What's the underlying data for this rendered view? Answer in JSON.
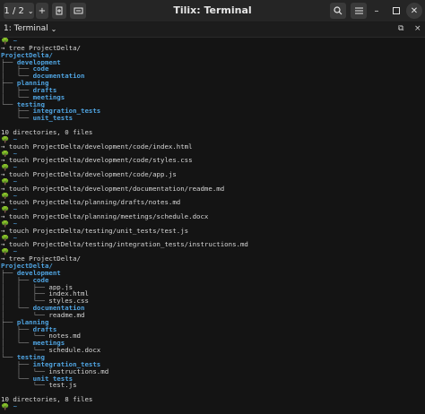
{
  "window": {
    "title": "Tilix: Terminal",
    "session_counter": "1 / 2",
    "add_label": "+",
    "icons": {
      "dropdown": "chevron-down-icon",
      "new_tab": "new-session-icon",
      "sync": "sync-input-icon",
      "search": "search-icon",
      "menu": "hamburger-menu-icon",
      "minimize": "minimize-icon",
      "maximize": "maximize-icon",
      "close": "close-icon"
    }
  },
  "tab": {
    "label": "1: Terminal",
    "maximize_glyph": "⧉",
    "close_glyph": "×"
  },
  "colors": {
    "prompt": "#6ab04c",
    "directory": "#4fa3e0",
    "tree": "#8a8a8a",
    "background": "#141414"
  },
  "terminal": {
    "prompt_symbol": "🌳",
    "tilde": "~",
    "arrow": "→",
    "lines": [
      {
        "t": "prompt"
      },
      {
        "t": "cmd",
        "text": "tree ProjectDelta/"
      },
      {
        "t": "tree",
        "prefix": "",
        "name": "ProjectDelta/",
        "dir": true
      },
      {
        "t": "tree",
        "prefix": "├── ",
        "name": "development",
        "dir": true
      },
      {
        "t": "tree",
        "prefix": "│   ├── ",
        "name": "code",
        "dir": true
      },
      {
        "t": "tree",
        "prefix": "│   └── ",
        "name": "documentation",
        "dir": true
      },
      {
        "t": "tree",
        "prefix": "├── ",
        "name": "planning",
        "dir": true
      },
      {
        "t": "tree",
        "prefix": "│   ├── ",
        "name": "drafts",
        "dir": true
      },
      {
        "t": "tree",
        "prefix": "│   └── ",
        "name": "meetings",
        "dir": true
      },
      {
        "t": "tree",
        "prefix": "└── ",
        "name": "testing",
        "dir": true
      },
      {
        "t": "tree",
        "prefix": "    ├── ",
        "name": "integration_tests",
        "dir": true
      },
      {
        "t": "tree",
        "prefix": "    └── ",
        "name": "unit_tests",
        "dir": true
      },
      {
        "t": "blank"
      },
      {
        "t": "out",
        "text": "10 directories, 0 files"
      },
      {
        "t": "prompt"
      },
      {
        "t": "cmd",
        "text": "touch ProjectDelta/development/code/index.html"
      },
      {
        "t": "prompt"
      },
      {
        "t": "cmd",
        "text": "touch ProjectDelta/development/code/styles.css"
      },
      {
        "t": "prompt"
      },
      {
        "t": "cmd",
        "text": "touch ProjectDelta/development/code/app.js"
      },
      {
        "t": "prompt"
      },
      {
        "t": "cmd",
        "text": "touch ProjectDelta/development/documentation/readme.md"
      },
      {
        "t": "prompt"
      },
      {
        "t": "cmd",
        "text": "touch ProjectDelta/planning/drafts/notes.md"
      },
      {
        "t": "prompt"
      },
      {
        "t": "cmd",
        "text": "touch ProjectDelta/planning/meetings/schedule.docx"
      },
      {
        "t": "prompt"
      },
      {
        "t": "cmd",
        "text": "touch ProjectDelta/testing/unit_tests/test.js"
      },
      {
        "t": "prompt"
      },
      {
        "t": "cmd",
        "text": "touch ProjectDelta/testing/integration_tests/instructions.md"
      },
      {
        "t": "prompt"
      },
      {
        "t": "cmd",
        "text": "tree ProjectDelta/"
      },
      {
        "t": "tree",
        "prefix": "",
        "name": "ProjectDelta/",
        "dir": true
      },
      {
        "t": "tree",
        "prefix": "├── ",
        "name": "development",
        "dir": true
      },
      {
        "t": "tree",
        "prefix": "│   ├── ",
        "name": "code",
        "dir": true
      },
      {
        "t": "tree",
        "prefix": "│   │   ├── ",
        "name": "app.js",
        "dir": false
      },
      {
        "t": "tree",
        "prefix": "│   │   ├── ",
        "name": "index.html",
        "dir": false
      },
      {
        "t": "tree",
        "prefix": "│   │   └── ",
        "name": "styles.css",
        "dir": false
      },
      {
        "t": "tree",
        "prefix": "│   └── ",
        "name": "documentation",
        "dir": true
      },
      {
        "t": "tree",
        "prefix": "│       └── ",
        "name": "readme.md",
        "dir": false
      },
      {
        "t": "tree",
        "prefix": "├── ",
        "name": "planning",
        "dir": true
      },
      {
        "t": "tree",
        "prefix": "│   ├── ",
        "name": "drafts",
        "dir": true
      },
      {
        "t": "tree",
        "prefix": "│   │   └── ",
        "name": "notes.md",
        "dir": false
      },
      {
        "t": "tree",
        "prefix": "│   └── ",
        "name": "meetings",
        "dir": true
      },
      {
        "t": "tree",
        "prefix": "│       └── ",
        "name": "schedule.docx",
        "dir": false
      },
      {
        "t": "tree",
        "prefix": "└── ",
        "name": "testing",
        "dir": true
      },
      {
        "t": "tree",
        "prefix": "    ├── ",
        "name": "integration_tests",
        "dir": true
      },
      {
        "t": "tree",
        "prefix": "    │   └── ",
        "name": "instructions.md",
        "dir": false
      },
      {
        "t": "tree",
        "prefix": "    └── ",
        "name": "unit_tests",
        "dir": true
      },
      {
        "t": "tree",
        "prefix": "        └── ",
        "name": "test.js",
        "dir": false
      },
      {
        "t": "blank"
      },
      {
        "t": "out",
        "text": "10 directories, 8 files"
      },
      {
        "t": "prompt"
      }
    ]
  }
}
